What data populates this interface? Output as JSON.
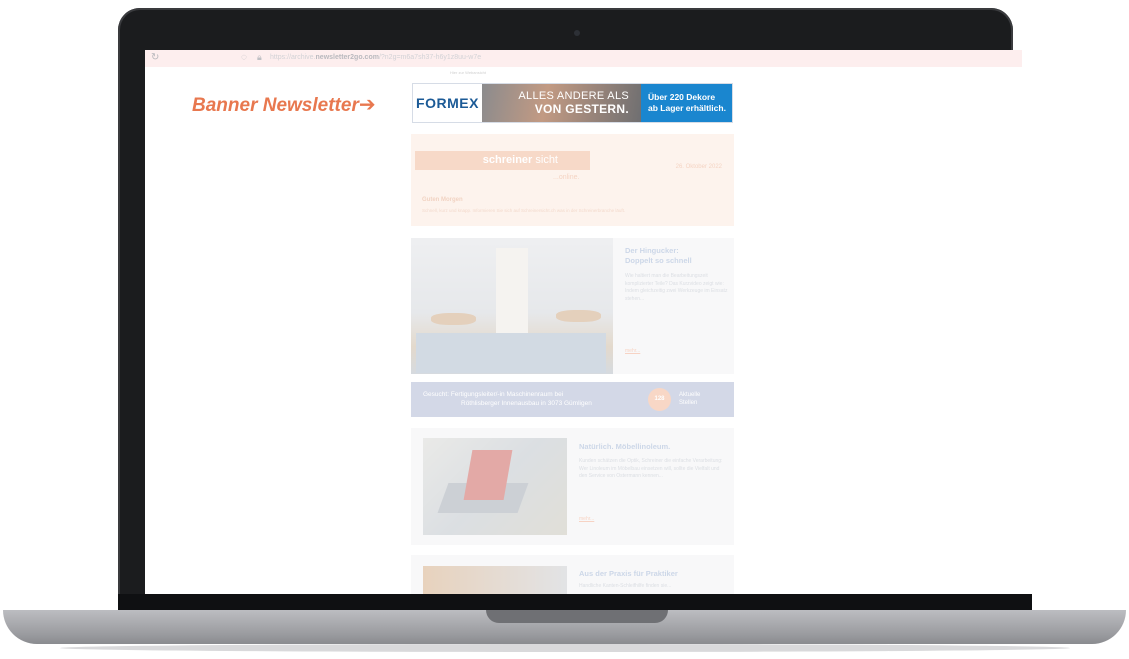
{
  "annotation": {
    "label": "Banner Newsletter",
    "arrow": "➔"
  },
  "browser": {
    "url_prefix": "https://archive.",
    "url_domain": "newsletter2go.com",
    "url_rest": "/?n2g=m6a7sh37-h6y1z8uu-w7e"
  },
  "newsletter": {
    "web_view_caption": "Hier zur Webansicht",
    "banner": {
      "logo": "FORMEX",
      "headline_line1": "ALLES ANDERE ALS",
      "headline_line2": "VON GESTERN.",
      "promo_line1": "Über 220 Dekore",
      "promo_line2": "ab Lager erhältlich."
    },
    "header": {
      "brand_main": "schreiner",
      "brand_accent": "sicht",
      "brand_sub": "...online.",
      "date": "26. Oktober 2022",
      "greeting": "Guten Morgen",
      "intro": "Schnell, kurz und knapp. Informieren Sie sich auf Schreinersicht.ch was in der Schreinerbranche läuft."
    },
    "article1": {
      "title_line1": "Der Hingucker:",
      "title_line2": "Doppelt so schnell",
      "text": "Wie haltiert man die Bearbeitungszeit komplizierter Teile? Das Kurzvideo zeigt wie: Indem gleichzeitig zwei Werkzeuge im Einsatz stehen...",
      "more": "mehr..."
    },
    "jobs": {
      "text_line1": "Gesucht: Fertigungsleiter/-in Maschinenraum bei",
      "text_line2": "Röthlisberger Innenausbau in 3073 Gümligen",
      "count": "128",
      "label_line1": "Aktuelle",
      "label_line2": "Stellen"
    },
    "article2": {
      "title": "Natürlich. Möbellinoleum.",
      "text": "Kunden schätzen die Optik, Schreiner die einfache Verarbeitung: Wer Linoleum im Möbelbau einsetzen will, sollte die Vielfalt und den Service von Ostermann kennen...",
      "more": "mehr..."
    },
    "article3": {
      "title": "Aus der Praxis für Praktiker",
      "text": "Handliche Kanten-Schleifhilfe finden sie..."
    }
  },
  "colors": {
    "annotation": "#e8784f",
    "formex_blue": "#1b5a96",
    "banner_blue": "#1a86cf",
    "header_peach": "#fde9dc",
    "jobs_blue": "#a9b3d1"
  }
}
